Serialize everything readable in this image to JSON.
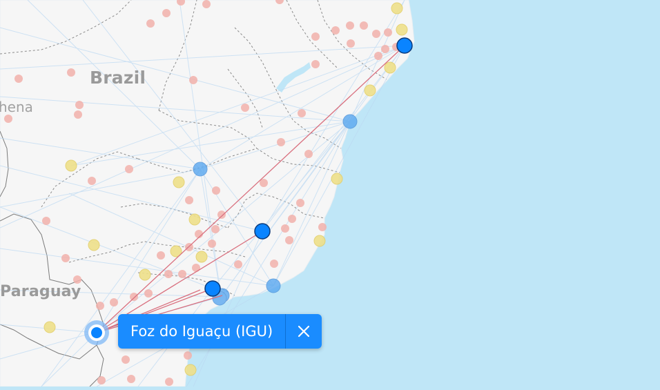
{
  "map": {
    "labels": {
      "brazil": "Brazil",
      "paraguay": "Paraguay",
      "partial_city": "hena"
    },
    "colors": {
      "ocean": "#bfe6f7",
      "land": "#f6f6f6",
      "route_line": "#d9707f",
      "selected_airport": "#0a84ff",
      "large_airport": "#5aa8f0",
      "medium_airport": "#efe08a",
      "small_airport": "#f2b1ab"
    }
  },
  "selection": {
    "airport_label": "Foz do Iguaçu (IGU)",
    "close_icon": "close-icon"
  }
}
